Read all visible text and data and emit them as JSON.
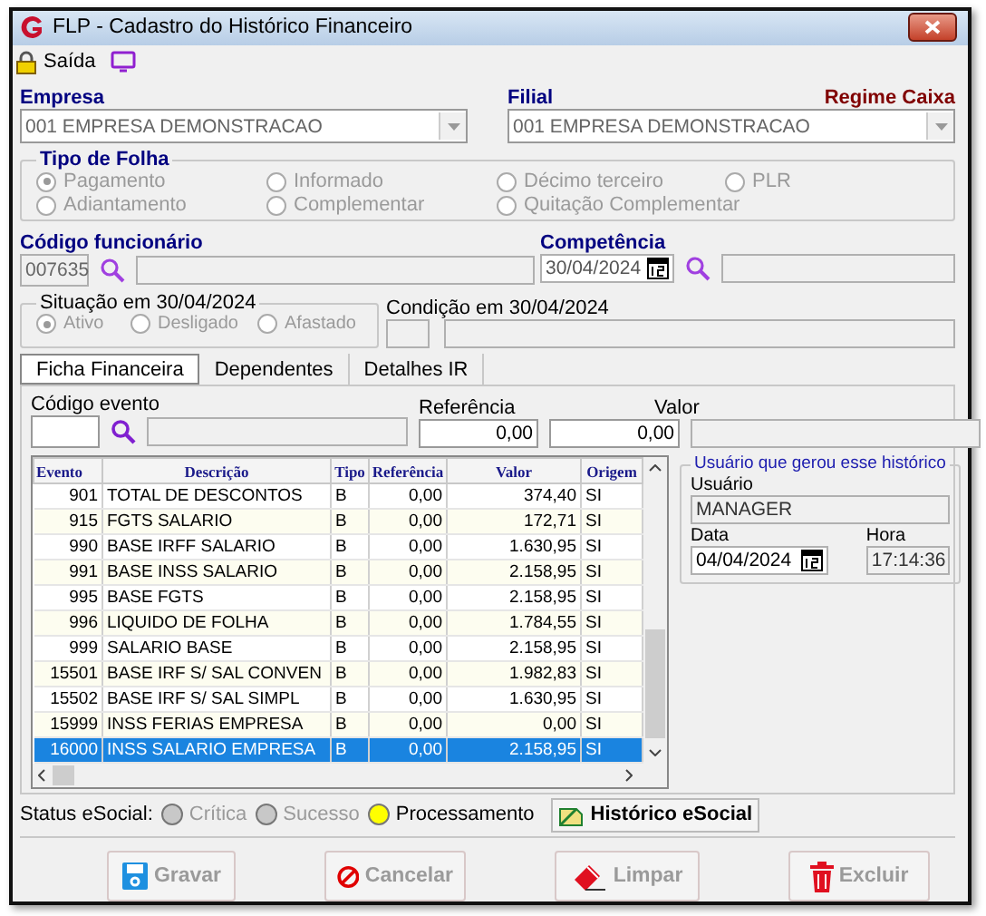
{
  "window": {
    "title": "FLP - Cadastro do Histórico Financeiro"
  },
  "toolbar": {
    "exit_label": "Saída"
  },
  "empresa": {
    "label": "Empresa",
    "value": "001 EMPRESA DEMONSTRACAO",
    "disabled": true
  },
  "filial": {
    "label": "Filial",
    "value": "001 EMPRESA DEMONSTRACAO",
    "regime": "Regime Caixa",
    "disabled": true
  },
  "tipo_folha": {
    "title": "Tipo de Folha",
    "disabled": true,
    "options": [
      {
        "label": "Pagamento",
        "selected": true
      },
      {
        "label": "Informado",
        "selected": false
      },
      {
        "label": "Décimo terceiro",
        "selected": false
      },
      {
        "label": "PLR",
        "selected": false
      },
      {
        "label": "Adiantamento",
        "selected": false
      },
      {
        "label": "Complementar",
        "selected": false
      },
      {
        "label": "Quitação Complementar",
        "selected": false
      }
    ]
  },
  "funcionario": {
    "label": "Código funcionário",
    "code": "007635"
  },
  "competencia": {
    "label": "Competência",
    "value": "30/04/2024"
  },
  "situacao": {
    "title": "Situação em  30/04/2024",
    "disabled": true,
    "options": [
      {
        "label": "Ativo",
        "selected": true
      },
      {
        "label": "Desligado",
        "selected": false
      },
      {
        "label": "Afastado",
        "selected": false
      }
    ]
  },
  "condicao": {
    "label": "Condição em 30/04/2024"
  },
  "tabs": [
    {
      "label": "Ficha Financeira",
      "selected": true
    },
    {
      "label": "Dependentes",
      "selected": false
    },
    {
      "label": "Detalhes IR",
      "selected": false
    }
  ],
  "evento": {
    "code_label": "Código evento",
    "ref_label": "Referência",
    "ref_value": "0,00",
    "value_label": "Valor",
    "value": "0,00"
  },
  "table": {
    "columns": [
      "Evento",
      "Descrição",
      "Tipo",
      "Referência",
      "Valor",
      "Origem"
    ],
    "rows": [
      {
        "cells": [
          "901",
          "TOTAL DE DESCONTOS",
          "B",
          "0,00",
          "374,40",
          "SI"
        ],
        "selected": false
      },
      {
        "cells": [
          "915",
          "FGTS SALARIO",
          "B",
          "0,00",
          "172,71",
          "SI"
        ],
        "selected": false
      },
      {
        "cells": [
          "990",
          "BASE IRFF SALARIO",
          "B",
          "0,00",
          "1.630,95",
          "SI"
        ],
        "selected": false
      },
      {
        "cells": [
          "991",
          "BASE INSS SALARIO",
          "B",
          "0,00",
          "2.158,95",
          "SI"
        ],
        "selected": false
      },
      {
        "cells": [
          "995",
          "BASE FGTS",
          "B",
          "0,00",
          "2.158,95",
          "SI"
        ],
        "selected": false
      },
      {
        "cells": [
          "996",
          "LIQUIDO DE FOLHA",
          "B",
          "0,00",
          "1.784,55",
          "SI"
        ],
        "selected": false
      },
      {
        "cells": [
          "999",
          "SALARIO BASE",
          "B",
          "0,00",
          "2.158,95",
          "SI"
        ],
        "selected": false
      },
      {
        "cells": [
          "15501",
          "BASE IRF S/ SAL CONVEN",
          "B",
          "0,00",
          "1.982,83",
          "SI"
        ],
        "selected": false
      },
      {
        "cells": [
          "15502",
          "BASE IRF S/ SAL SIMPL",
          "B",
          "0,00",
          "1.630,95",
          "SI"
        ],
        "selected": false
      },
      {
        "cells": [
          "15999",
          "INSS FERIAS EMPRESA",
          "B",
          "0,00",
          "0,00",
          "SI"
        ],
        "selected": false
      },
      {
        "cells": [
          "16000",
          "INSS SALARIO EMPRESA",
          "B",
          "0,00",
          "2.158,95",
          "SI"
        ],
        "selected": true
      }
    ]
  },
  "usuario": {
    "title": "Usuário que gerou esse histórico",
    "user_label": "Usuário",
    "user": "MANAGER",
    "date_label": "Data",
    "date": "04/04/2024",
    "time_label": "Hora",
    "time": "17:14:36"
  },
  "status": {
    "label": "Status eSocial:",
    "items": [
      {
        "label": "Crítica",
        "color": "#c8c8c8",
        "disabled": true
      },
      {
        "label": "Sucesso",
        "color": "#c8c8c8",
        "disabled": true
      },
      {
        "label": "Processamento",
        "color": "#ffff00",
        "disabled": false
      }
    ],
    "history_button": "Histórico eSocial"
  },
  "buttons": [
    {
      "label": "Gravar",
      "kind": "save",
      "disabled": true
    },
    {
      "label": "Cancelar",
      "kind": "cancel",
      "disabled": true
    },
    {
      "label": "Limpar",
      "kind": "clear",
      "disabled": true
    },
    {
      "label": "Excluir",
      "kind": "delete",
      "disabled": true
    }
  ]
}
